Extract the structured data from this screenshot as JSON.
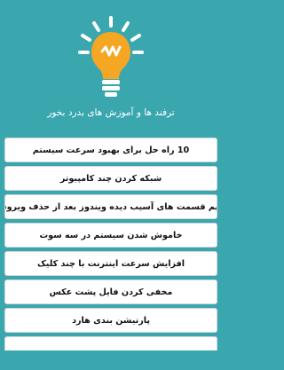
{
  "header": {
    "title": "ترفند ها و آموزش های بدرد بخور",
    "icon": "lightbulb-icon",
    "bg_color": "#3aa6ae",
    "bulb_color": "#f5a623"
  },
  "menu": {
    "items": [
      {
        "label": "10 راه حل برای بهبود سرعت سیستم"
      },
      {
        "label": "شبکه کردن چند کامپیوتر"
      },
      {
        "label": "ترمیم قسمت های آسیب دیده ویندوز بعد از حذف ویروسها"
      },
      {
        "label": "خاموش شدن سیستم در سه سوت"
      },
      {
        "label": "افزایش سرعت اینترنت با چند کلیک"
      },
      {
        "label": "مخفی کردن فایل پشت عکس"
      },
      {
        "label": "پارتیشن بندی هارد"
      }
    ]
  }
}
